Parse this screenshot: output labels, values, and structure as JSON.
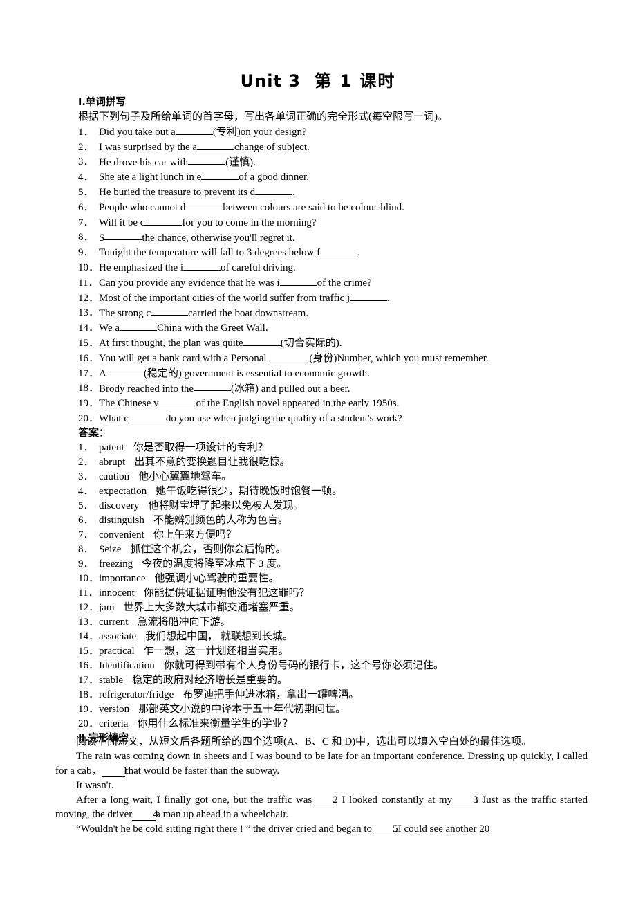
{
  "document": {
    "title_en": "Unit 3",
    "title_cn": "第 1 课时"
  },
  "section1": {
    "heading": "Ⅰ.单词拼写",
    "instruction": "根据下列句子及所给单词的首字母，写出各单词正确的完全形式(每空限写一词)。",
    "questions": [
      {
        "n": "1．",
        "pre": "Did you take out a",
        "post": "(专利)on your design?"
      },
      {
        "n": "2．",
        "pre": "I was surprised by the a",
        "post": "change of subject."
      },
      {
        "n": "3．",
        "pre": "He drove his car with",
        "post": "(谨慎)."
      },
      {
        "n": "4．",
        "pre": "She ate a light lunch in e",
        "post": "of a good dinner."
      },
      {
        "n": "5．",
        "pre": "He buried the treasure to prevent its d",
        "post": "."
      },
      {
        "n": "6．",
        "pre": "People who cannot d",
        "post": "between colours are said to be colour-blind."
      },
      {
        "n": "7．",
        "pre": "Will it be c",
        "post": "for you to come in the morning?"
      },
      {
        "n": "8．",
        "pre": "S",
        "post": "the chance, otherwise you'll regret it."
      },
      {
        "n": "9．",
        "pre": "Tonight the temperature will fall to 3 degrees below f",
        "post": "."
      },
      {
        "n": "10．",
        "pre": "He emphasized the i",
        "post": "of careful driving."
      },
      {
        "n": "11．",
        "pre": "Can you provide any evidence that he was i",
        "post": "of the crime?"
      },
      {
        "n": "12．",
        "pre": "Most of the important cities of the world suffer from traffic j",
        "post": "."
      },
      {
        "n": "13．",
        "pre": "The strong c",
        "post": "carried the boat downstream."
      },
      {
        "n": "14．",
        "pre": "We a",
        "post": "China with the Greet Wall."
      },
      {
        "n": "15．",
        "pre": "At first thought, the plan was quite",
        "post": "(切合实际的)."
      },
      {
        "n": "16．",
        "pre": "You will get a bank card with a Personal ",
        "post": "(身份)Number, which you must remember."
      },
      {
        "n": "17．",
        "pre": "A",
        "post": "(稳定的) government is essential to economic growth."
      },
      {
        "n": "18．",
        "pre": "Brody reached into the",
        "post": "(冰箱) and pulled out a beer."
      },
      {
        "n": "19．",
        "pre": "The Chinese v",
        "post": "of the English novel appeared in the early 1950s."
      },
      {
        "n": "20．",
        "pre": "What c",
        "post": "do you use when judging the quality of a student's work?"
      }
    ],
    "answers_heading": "答案：",
    "answers": [
      {
        "n": "1．",
        "word": "patent",
        "cn": "你是否取得一项设计的专利？"
      },
      {
        "n": "2．",
        "word": "abrupt",
        "cn": "出其不意的变换题目让我很吃惊。"
      },
      {
        "n": "3．",
        "word": "caution",
        "cn": "他小心翼翼地驾车。"
      },
      {
        "n": "4．",
        "word": "expectation",
        "cn": "她午饭吃得很少，期待晚饭时饱餐一顿。"
      },
      {
        "n": "5．",
        "word": "discovery",
        "cn": "他将财宝埋了起来以免被人发现。"
      },
      {
        "n": "6．",
        "word": "distinguish",
        "cn": "不能辨别颜色的人称为色盲。"
      },
      {
        "n": "7．",
        "word": "convenient",
        "cn": "你上午来方便吗？"
      },
      {
        "n": "8．",
        "word": "Seize",
        "cn": "抓住这个机会，否则你会后悔的。"
      },
      {
        "n": "9．",
        "word": "freezing",
        "cn": "今夜的温度将降至冰点下 3 度。"
      },
      {
        "n": "10．",
        "word": "importance",
        "cn": "他强调小心驾驶的重要性。"
      },
      {
        "n": "11．",
        "word": "innocent",
        "cn": "你能提供证据证明他没有犯这罪吗？"
      },
      {
        "n": "12．",
        "word": "jam",
        "cn": "世界上大多数大城市都交通堵塞严重。"
      },
      {
        "n": "13．",
        "word": "current",
        "cn": "急流将船冲向下游。"
      },
      {
        "n": "14．",
        "word": "associate",
        "cn": "我们想起中国， 就联想到长城。"
      },
      {
        "n": "15．",
        "word": "practical",
        "cn": "乍一想，这一计划还相当实用。"
      },
      {
        "n": "16．",
        "word": "Identification",
        "cn": "你就可得到带有个人身份号码的银行卡，这个号你必须记住。"
      },
      {
        "n": "17．",
        "word": "stable",
        "cn": "稳定的政府对经济增长是重要的。"
      },
      {
        "n": "18．",
        "word": "refrigerator/fridge",
        "cn": "布罗迪把手伸进冰箱，拿出一罐啤酒。"
      },
      {
        "n": "19．",
        "word": "version",
        "cn": "那部英文小说的中译本于五十年代初期问世。"
      },
      {
        "n": "20．",
        "word": "criteria",
        "cn": "你用什么标准来衡量学生的学业？"
      }
    ]
  },
  "section2": {
    "heading": "Ⅱ.完形填空",
    "instruction": "阅读下面短文，从短文后各题所给的四个选项(A、B、C 和 D)中，选出可以填入空白处的最佳选项。",
    "para1_a": "The rain was coming down in sheets and I was bound to be late for an important conference. Dressing up quickly, I called for a cab，",
    "para1_blank": "1",
    "para1_b": "that would be faster than the subway.",
    "para2": "It wasn't.",
    "para3_a": "After a long wait, I finally got one, but the traffic was",
    "para3_blank1": "2",
    "para3_b": ". I looked constantly at my",
    "para3_blank2": "3",
    "para3_c": ". Just as the traffic started moving, the driver",
    "para3_blank3": "4",
    "para3_d": "a man up ahead in a wheelchair.",
    "para4_a": "“Wouldn't he be cold sitting right there !  ”  the driver cried and began to",
    "para4_blank": "5",
    "para4_b": ".I could see another 20"
  }
}
